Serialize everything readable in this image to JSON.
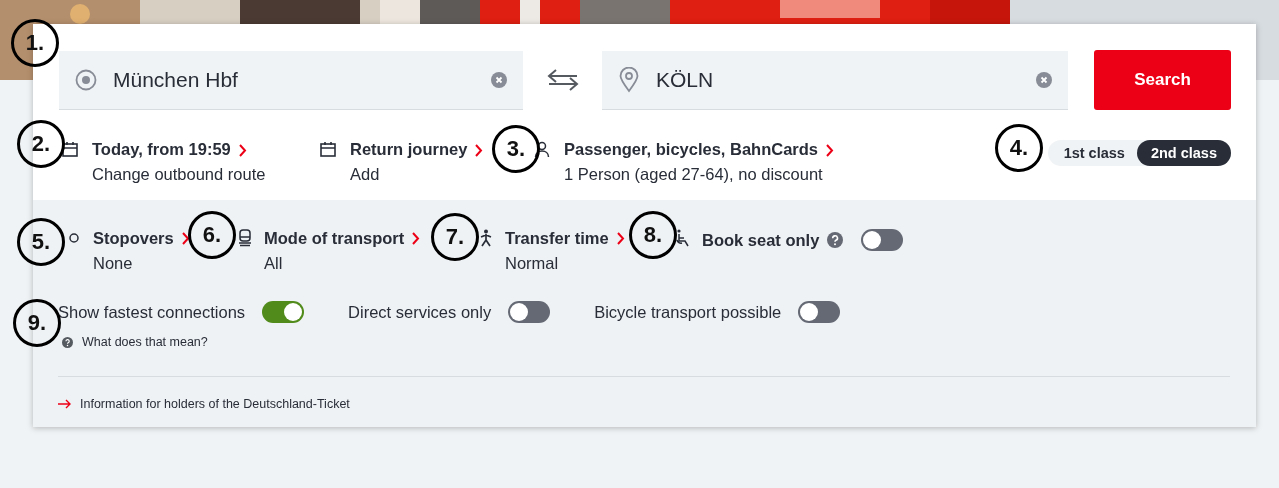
{
  "journey": {
    "from": {
      "value": "München Hbf"
    },
    "to": {
      "value": "KÖLN"
    },
    "search_button": "Search"
  },
  "options": [
    {
      "kind": "date",
      "title": "Today, from 19:59",
      "subtitle": "Change outbound route"
    },
    {
      "kind": "date",
      "title": "Return journey",
      "subtitle": "Add"
    },
    {
      "kind": "person",
      "title": "Passenger, bicycles, BahnCards",
      "subtitle": "1 Person (aged 27-64), no discount"
    }
  ],
  "travel_class": [
    {
      "label": "1st class",
      "selected": false
    },
    {
      "label": "2nd class",
      "selected": true
    }
  ],
  "filters": [
    {
      "kind": "stopovers",
      "title": "Stopovers",
      "value": "None"
    },
    {
      "kind": "transport",
      "title": "Mode of transport",
      "value": "All"
    },
    {
      "kind": "transfer",
      "title": "Transfer time",
      "value": "Normal"
    },
    {
      "kind": "seat",
      "title": "Book seat only",
      "on": false
    }
  ],
  "toggles": [
    {
      "label": "Show fastest connections",
      "on": true
    },
    {
      "label": "Direct services only",
      "on": false
    },
    {
      "label": "Bicycle transport possible",
      "on": false
    }
  ],
  "help_link": "What does that mean?",
  "info_link": "Information for holders of the Deutschland-Ticket",
  "annotations": [
    {
      "label": "1."
    },
    {
      "label": "2."
    },
    {
      "label": "3."
    },
    {
      "label": "4."
    },
    {
      "label": "5."
    },
    {
      "label": "6."
    },
    {
      "label": "7."
    },
    {
      "label": "8."
    },
    {
      "label": "9."
    }
  ]
}
